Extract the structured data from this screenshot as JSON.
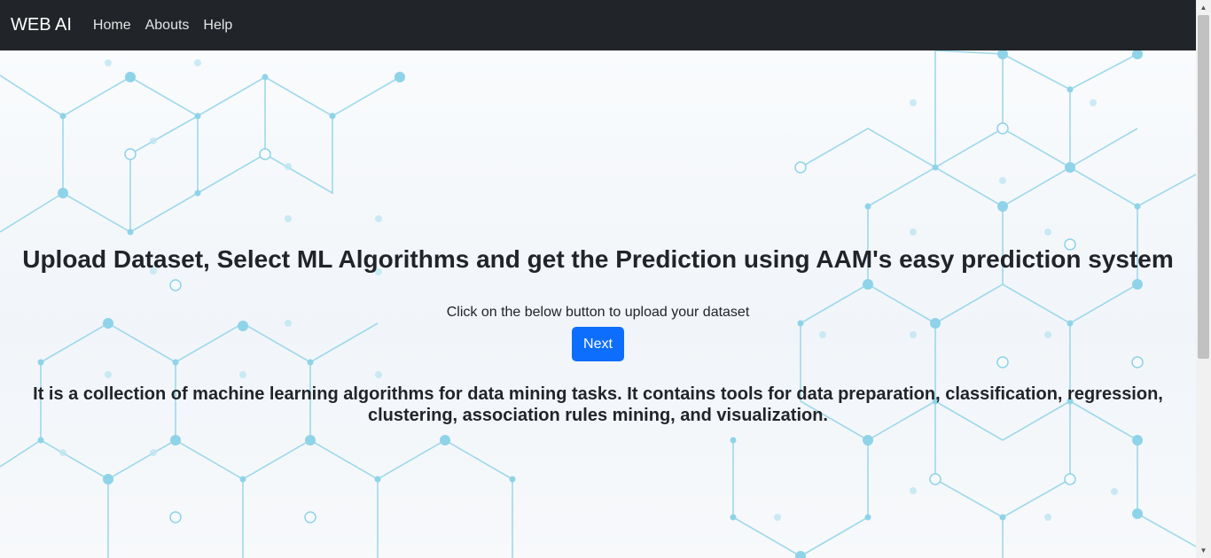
{
  "navbar": {
    "brand": "WEB AI",
    "links": [
      {
        "label": "Home"
      },
      {
        "label": "Abouts"
      },
      {
        "label": "Help"
      }
    ],
    "background": "#212529"
  },
  "main": {
    "headline": "Upload Dataset, Select ML Algorithms and get the Prediction using AAM's easy prediction system",
    "subtext": "Click on the below button to upload your dataset",
    "next_button": "Next",
    "description": "It is a collection of machine learning algorithms for data mining tasks. It contains tools for data preparation, classification, regression, clustering, association rules mining, and visualization."
  },
  "colors": {
    "accent": "#0d6efd",
    "pattern": "#8fd3e8"
  }
}
